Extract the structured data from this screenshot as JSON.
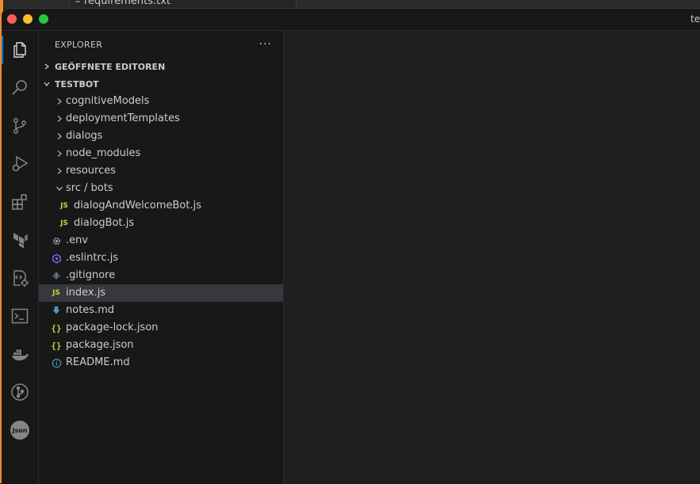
{
  "background": {
    "behind_window_file": "requirements.txt"
  },
  "window": {
    "title": "te"
  },
  "activity_bar": {
    "items": [
      {
        "name": "explorer",
        "icon": "files-icon",
        "active": true
      },
      {
        "name": "search",
        "icon": "search-icon"
      },
      {
        "name": "source-control",
        "icon": "source-control-icon"
      },
      {
        "name": "run-debug",
        "icon": "run-debug-icon"
      },
      {
        "name": "extensions",
        "icon": "extensions-icon"
      },
      {
        "name": "terraform",
        "icon": "terraform-icon"
      },
      {
        "name": "remote-explorer",
        "icon": "remote-explorer-icon"
      },
      {
        "name": "terminal",
        "icon": "terminal-icon"
      },
      {
        "name": "docker",
        "icon": "docker-icon"
      },
      {
        "name": "git-graph",
        "icon": "git-graph-icon"
      },
      {
        "name": "json",
        "icon": "json-icon",
        "label": "Json"
      }
    ]
  },
  "sidebar": {
    "title": "EXPLORER",
    "more_label": "···",
    "open_editors_label": "GEÖFFNETE EDITOREN",
    "project_label": "TESTBOT",
    "tree": [
      {
        "label": "cognitiveModels",
        "type": "folder",
        "expanded": false
      },
      {
        "label": "deploymentTemplates",
        "type": "folder",
        "expanded": false
      },
      {
        "label": "dialogs",
        "type": "folder",
        "expanded": false
      },
      {
        "label": "node_modules",
        "type": "folder",
        "expanded": false
      },
      {
        "label": "resources",
        "type": "folder",
        "expanded": false
      },
      {
        "label": "src / bots",
        "type": "folder",
        "expanded": true
      },
      {
        "label": "dialogAndWelcomeBot.js",
        "type": "js",
        "indent": 1
      },
      {
        "label": "dialogBot.js",
        "type": "js",
        "indent": 1
      },
      {
        "label": ".env",
        "type": "env"
      },
      {
        "label": ".eslintrc.js",
        "type": "eslint"
      },
      {
        "label": ".gitignore",
        "type": "git"
      },
      {
        "label": "index.js",
        "type": "js",
        "selected": true
      },
      {
        "label": "notes.md",
        "type": "md-download"
      },
      {
        "label": "package-lock.json",
        "type": "json"
      },
      {
        "label": "package.json",
        "type": "json"
      },
      {
        "label": "README.md",
        "type": "info"
      }
    ]
  },
  "colors": {
    "accent": "#0078d4",
    "js": "#cbcb41",
    "eslint": "#8b5cf6",
    "notes": "#519aba",
    "info": "#519aba"
  }
}
